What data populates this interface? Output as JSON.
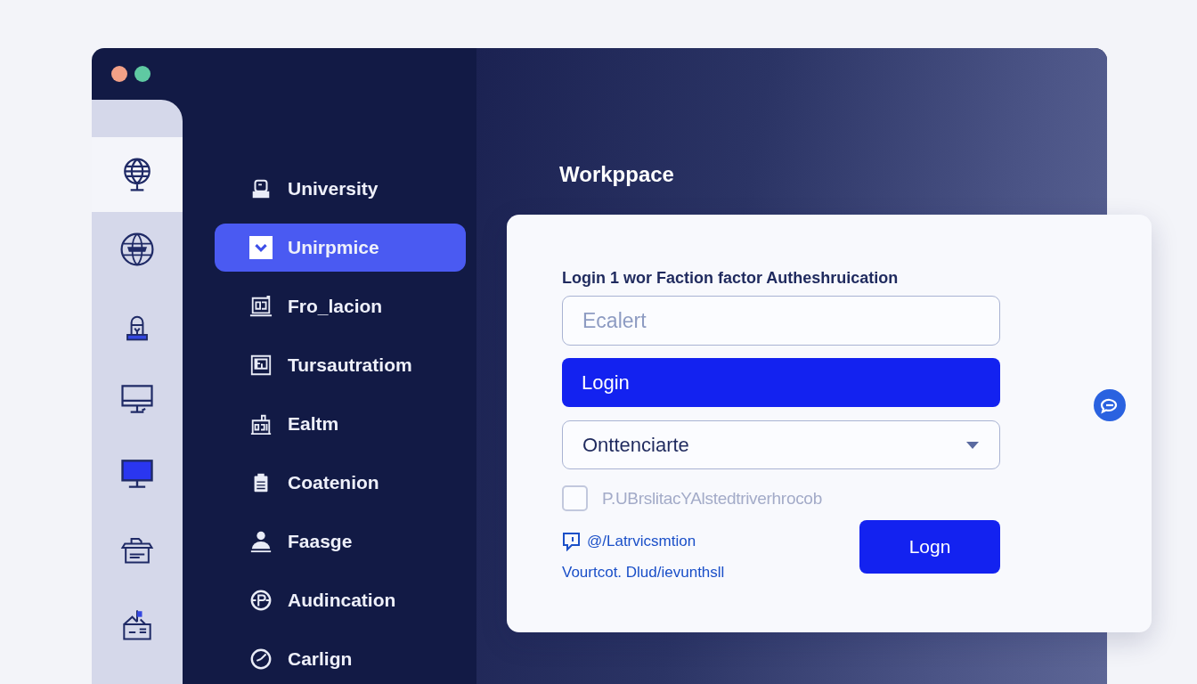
{
  "window": {
    "controls": [
      {
        "color": "#f2a087"
      },
      {
        "color": "#5fc9a2"
      }
    ]
  },
  "icon_rail": {
    "items": [
      {
        "selected": true
      },
      {
        "selected": false
      },
      {
        "selected": false
      },
      {
        "selected": false
      },
      {
        "selected": false
      },
      {
        "selected": false
      },
      {
        "selected": false
      }
    ]
  },
  "nav": {
    "items": [
      {
        "label": "University",
        "selected": false
      },
      {
        "label": "Unirpmice",
        "selected": true
      },
      {
        "label": "Fro_lacion",
        "selected": false
      },
      {
        "label": "Tursautratiom",
        "selected": false
      },
      {
        "label": "Ealtm",
        "selected": false
      },
      {
        "label": "Coatenion",
        "selected": false
      },
      {
        "label": "Faasge",
        "selected": false
      },
      {
        "label": "Audincation",
        "selected": false
      },
      {
        "label": "Carlign",
        "selected": false
      }
    ]
  },
  "workspace": {
    "title": "Workppace"
  },
  "login_card": {
    "heading": "Login 1 wor Faction factor Autheshruication",
    "email_field": {
      "placeholder": "Ecalert"
    },
    "login_bar": "Login",
    "dropdown": {
      "value": "Onttenciarte"
    },
    "checkbox": {
      "label": "P.UBrslitacYAlstedtriverhrocob",
      "checked": false
    },
    "links": [
      "@/Latrvicsmtion",
      "Vourtcot. Dlud/ievunthsll"
    ],
    "submit_button": "Logn"
  }
}
